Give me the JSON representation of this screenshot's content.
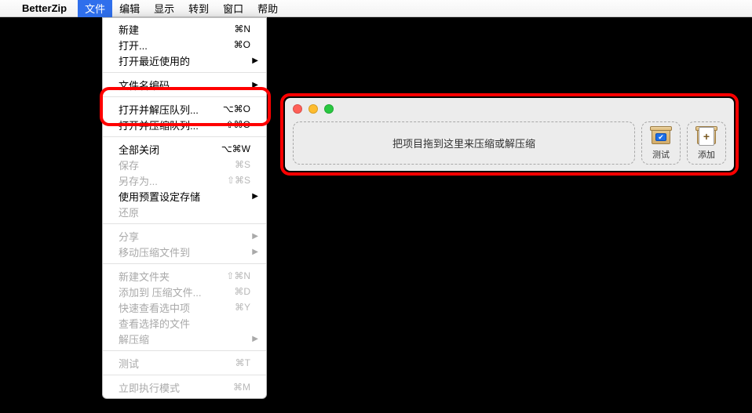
{
  "menubar": {
    "app": "BetterZip",
    "items": [
      "文件",
      "编辑",
      "显示",
      "转到",
      "窗口",
      "帮助"
    ],
    "active_index": 0
  },
  "dropdown": {
    "rows": [
      {
        "label": "新建",
        "shortcut": "⌘N",
        "disabled": false
      },
      {
        "label": "打开...",
        "shortcut": "⌘O",
        "disabled": false
      },
      {
        "label": "打开最近使用的",
        "submenu": true,
        "disabled": false
      },
      {
        "sep": true
      },
      {
        "label": "文件名编码",
        "submenu": true,
        "disabled": false
      },
      {
        "sep": true
      },
      {
        "label": "打开并解压队列...",
        "shortcut": "⌥⌘O",
        "disabled": false
      },
      {
        "label": "打开并压缩队列...",
        "shortcut": "⇧⌘O",
        "disabled": false
      },
      {
        "sep": true
      },
      {
        "label": "全部关闭",
        "shortcut": "⌥⌘W",
        "disabled": false
      },
      {
        "label": "保存",
        "shortcut": "⌘S",
        "disabled": true
      },
      {
        "label": "另存为...",
        "shortcut": "⇧⌘S",
        "disabled": true
      },
      {
        "label": "使用预置设定存储",
        "submenu": true,
        "disabled": false
      },
      {
        "label": "还原",
        "disabled": true
      },
      {
        "sep": true
      },
      {
        "label": "分享",
        "submenu": true,
        "disabled": true
      },
      {
        "label": "移动压缩文件到",
        "submenu": true,
        "disabled": true
      },
      {
        "sep": true
      },
      {
        "label": "新建文件夹",
        "shortcut": "⇧⌘N",
        "disabled": true
      },
      {
        "label": "添加到 压缩文件...",
        "shortcut": "⌘D",
        "disabled": true
      },
      {
        "label": "快速查看选中项",
        "shortcut": "⌘Y",
        "disabled": true
      },
      {
        "label": "查看选择的文件",
        "disabled": true
      },
      {
        "label": "解压缩",
        "submenu": true,
        "disabled": true
      },
      {
        "sep": true
      },
      {
        "label": "测试",
        "shortcut": "⌘T",
        "disabled": true
      },
      {
        "sep": true
      },
      {
        "label": "立即执行模式",
        "shortcut": "⌘M",
        "disabled": true
      }
    ]
  },
  "queue_window": {
    "dropzone_text": "把项目拖到这里来压缩或解压缩",
    "test_label": "测试",
    "add_label": "添加"
  }
}
